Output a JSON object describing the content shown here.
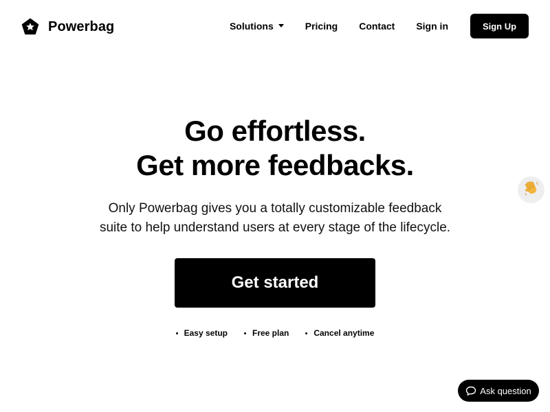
{
  "brand": {
    "name": "Powerbag",
    "icon": "pentagon-star-icon"
  },
  "nav": {
    "solutions": "Solutions",
    "pricing": "Pricing",
    "contact": "Contact",
    "sign_in": "Sign in",
    "sign_up": "Sign Up"
  },
  "hero": {
    "headline_line1": "Go effortless.",
    "headline_line2": "Get more feedbacks.",
    "subtext_line1": "Only Powerbag gives you a totally customizable feedback",
    "subtext_line2": "suite to help understand users at every stage of the lifecycle.",
    "cta": "Get started",
    "features": [
      "Easy setup",
      "Free plan",
      "Cancel anytime"
    ]
  },
  "widgets": {
    "wave_icon": "waving-hand-icon",
    "ask_question": "Ask question",
    "ask_icon": "chat-bubble-icon"
  },
  "colors": {
    "primary": "#000000",
    "background": "#ffffff",
    "wave_bg": "#eeeeee"
  }
}
